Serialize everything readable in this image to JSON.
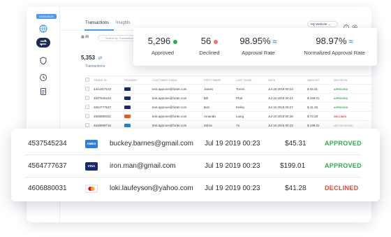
{
  "app": {
    "env_badge": "SANDBOX",
    "tabs": [
      {
        "label": "Transactions"
      },
      {
        "label": "Insights"
      }
    ],
    "site_select": "My Website",
    "filter": {
      "all_label": "All",
      "search_placeholder": "Search by Transaction ID, Email"
    },
    "summary": {
      "count": "5,353",
      "label": "Transactions"
    },
    "columns": [
      "TRANS ID",
      "PAYMENT",
      "CUSTOMER EMAIL",
      "FIRST NAME",
      "LAST NAME",
      "DATE",
      "AMOUNT",
      "DECISION"
    ],
    "rows": [
      {
        "id": "4444317122",
        "card": "visa",
        "email": "test.approve@forter.com",
        "first": "James",
        "last": "Torres",
        "date": "Jul 19 2019 00:23",
        "amount": "$ 45.31",
        "decision": "APPROVED"
      },
      {
        "id": "4537545234",
        "card": "visa",
        "email": "test.approve@forter.com",
        "first": "Bill",
        "last": "Phat",
        "date": "Jul 19 2019 00:24",
        "amount": "$ 199.01",
        "decision": "APPROVED"
      },
      {
        "id": "4564777637",
        "card": "visa",
        "email": "test.approve@forter.com",
        "first": "Bob",
        "last": "Kelley",
        "date": "Jul 19 2019 00:27",
        "amount": "$ 41.28",
        "decision": "APPROVED"
      },
      {
        "id": "4606880031",
        "card": "mastercard",
        "email": "test.approve@forter.com",
        "first": "Amanda",
        "last": "Liang",
        "date": "Jul 19 2019 00:28",
        "amount": "$ 73.28",
        "decision": "DECLINED"
      },
      {
        "id": "4548889716",
        "card": "paypal",
        "email": "test.approve@forter.com",
        "first": "Zebra",
        "last": "Yu",
        "date": "Jul 19 2019 00:23",
        "amount": "$ 199.01",
        "decision": "NOT REVIEWED"
      }
    ]
  },
  "stats": [
    {
      "value": "5,296",
      "label": "Approved",
      "marker": "green-dot"
    },
    {
      "value": "56",
      "label": "Declined",
      "marker": "red-dot"
    },
    {
      "value": "98.95%",
      "label": "Approval Rate",
      "marker": "trend-icon"
    },
    {
      "value": "98.97%",
      "label": "Normalized Approval Rate",
      "marker": "trend-icon"
    }
  ],
  "zoom_rows": [
    {
      "id": "4537545234",
      "card": "AMEX",
      "email": "buckey.barnes@gmail.com",
      "date": "Jul 19 2019  00:23",
      "amount": "$45.31",
      "decision": "APPROVED"
    },
    {
      "id": "4564777637",
      "card": "VISA",
      "email": "iron.man@gmail.com",
      "date": "Jul 19 2019  00:23",
      "amount": "$199.01",
      "decision": "APPROVED"
    },
    {
      "id": "4606880031",
      "card": "MASTERCARD",
      "email": "loki.laufeyson@yahoo.com",
      "date": "Jul 19 2019  00:23",
      "amount": "$41.28",
      "decision": "DECLINED"
    }
  ],
  "colors": {
    "approved": "#2fae4a",
    "declined": "#e0463b",
    "accent": "#4c9be8",
    "nav_active": "#1e2d4f"
  }
}
